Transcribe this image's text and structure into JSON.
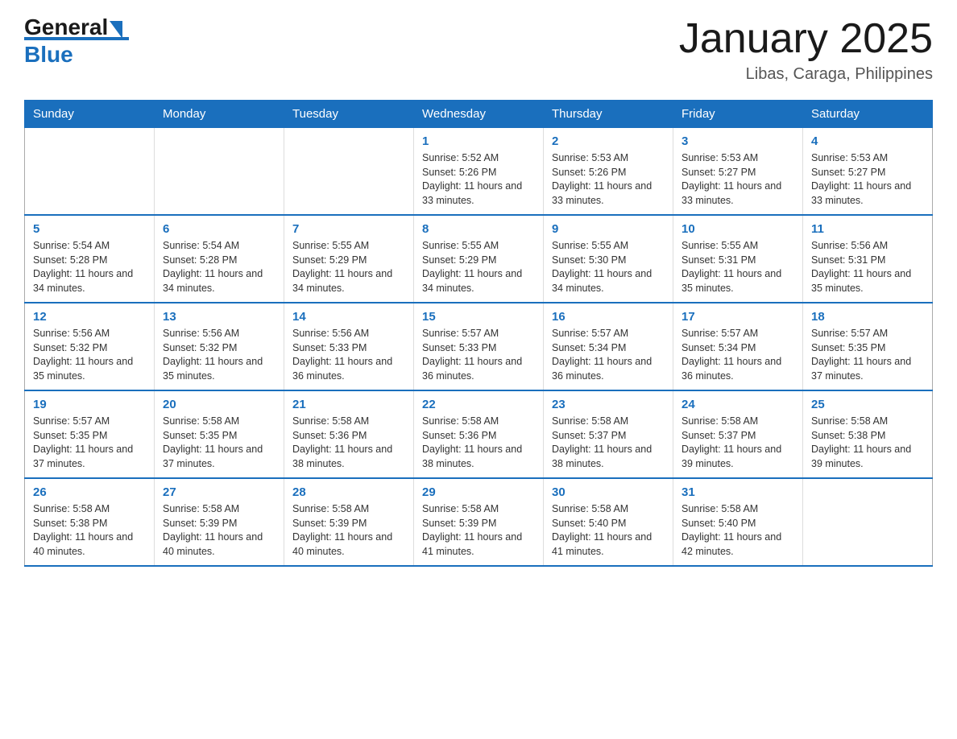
{
  "header": {
    "logo_general": "General",
    "logo_blue": "Blue",
    "month_title": "January 2025",
    "location": "Libas, Caraga, Philippines"
  },
  "days_of_week": [
    "Sunday",
    "Monday",
    "Tuesday",
    "Wednesday",
    "Thursday",
    "Friday",
    "Saturday"
  ],
  "weeks": [
    [
      {
        "num": "",
        "info": ""
      },
      {
        "num": "",
        "info": ""
      },
      {
        "num": "",
        "info": ""
      },
      {
        "num": "1",
        "info": "Sunrise: 5:52 AM\nSunset: 5:26 PM\nDaylight: 11 hours and 33 minutes."
      },
      {
        "num": "2",
        "info": "Sunrise: 5:53 AM\nSunset: 5:26 PM\nDaylight: 11 hours and 33 minutes."
      },
      {
        "num": "3",
        "info": "Sunrise: 5:53 AM\nSunset: 5:27 PM\nDaylight: 11 hours and 33 minutes."
      },
      {
        "num": "4",
        "info": "Sunrise: 5:53 AM\nSunset: 5:27 PM\nDaylight: 11 hours and 33 minutes."
      }
    ],
    [
      {
        "num": "5",
        "info": "Sunrise: 5:54 AM\nSunset: 5:28 PM\nDaylight: 11 hours and 34 minutes."
      },
      {
        "num": "6",
        "info": "Sunrise: 5:54 AM\nSunset: 5:28 PM\nDaylight: 11 hours and 34 minutes."
      },
      {
        "num": "7",
        "info": "Sunrise: 5:55 AM\nSunset: 5:29 PM\nDaylight: 11 hours and 34 minutes."
      },
      {
        "num": "8",
        "info": "Sunrise: 5:55 AM\nSunset: 5:29 PM\nDaylight: 11 hours and 34 minutes."
      },
      {
        "num": "9",
        "info": "Sunrise: 5:55 AM\nSunset: 5:30 PM\nDaylight: 11 hours and 34 minutes."
      },
      {
        "num": "10",
        "info": "Sunrise: 5:55 AM\nSunset: 5:31 PM\nDaylight: 11 hours and 35 minutes."
      },
      {
        "num": "11",
        "info": "Sunrise: 5:56 AM\nSunset: 5:31 PM\nDaylight: 11 hours and 35 minutes."
      }
    ],
    [
      {
        "num": "12",
        "info": "Sunrise: 5:56 AM\nSunset: 5:32 PM\nDaylight: 11 hours and 35 minutes."
      },
      {
        "num": "13",
        "info": "Sunrise: 5:56 AM\nSunset: 5:32 PM\nDaylight: 11 hours and 35 minutes."
      },
      {
        "num": "14",
        "info": "Sunrise: 5:56 AM\nSunset: 5:33 PM\nDaylight: 11 hours and 36 minutes."
      },
      {
        "num": "15",
        "info": "Sunrise: 5:57 AM\nSunset: 5:33 PM\nDaylight: 11 hours and 36 minutes."
      },
      {
        "num": "16",
        "info": "Sunrise: 5:57 AM\nSunset: 5:34 PM\nDaylight: 11 hours and 36 minutes."
      },
      {
        "num": "17",
        "info": "Sunrise: 5:57 AM\nSunset: 5:34 PM\nDaylight: 11 hours and 36 minutes."
      },
      {
        "num": "18",
        "info": "Sunrise: 5:57 AM\nSunset: 5:35 PM\nDaylight: 11 hours and 37 minutes."
      }
    ],
    [
      {
        "num": "19",
        "info": "Sunrise: 5:57 AM\nSunset: 5:35 PM\nDaylight: 11 hours and 37 minutes."
      },
      {
        "num": "20",
        "info": "Sunrise: 5:58 AM\nSunset: 5:35 PM\nDaylight: 11 hours and 37 minutes."
      },
      {
        "num": "21",
        "info": "Sunrise: 5:58 AM\nSunset: 5:36 PM\nDaylight: 11 hours and 38 minutes."
      },
      {
        "num": "22",
        "info": "Sunrise: 5:58 AM\nSunset: 5:36 PM\nDaylight: 11 hours and 38 minutes."
      },
      {
        "num": "23",
        "info": "Sunrise: 5:58 AM\nSunset: 5:37 PM\nDaylight: 11 hours and 38 minutes."
      },
      {
        "num": "24",
        "info": "Sunrise: 5:58 AM\nSunset: 5:37 PM\nDaylight: 11 hours and 39 minutes."
      },
      {
        "num": "25",
        "info": "Sunrise: 5:58 AM\nSunset: 5:38 PM\nDaylight: 11 hours and 39 minutes."
      }
    ],
    [
      {
        "num": "26",
        "info": "Sunrise: 5:58 AM\nSunset: 5:38 PM\nDaylight: 11 hours and 40 minutes."
      },
      {
        "num": "27",
        "info": "Sunrise: 5:58 AM\nSunset: 5:39 PM\nDaylight: 11 hours and 40 minutes."
      },
      {
        "num": "28",
        "info": "Sunrise: 5:58 AM\nSunset: 5:39 PM\nDaylight: 11 hours and 40 minutes."
      },
      {
        "num": "29",
        "info": "Sunrise: 5:58 AM\nSunset: 5:39 PM\nDaylight: 11 hours and 41 minutes."
      },
      {
        "num": "30",
        "info": "Sunrise: 5:58 AM\nSunset: 5:40 PM\nDaylight: 11 hours and 41 minutes."
      },
      {
        "num": "31",
        "info": "Sunrise: 5:58 AM\nSunset: 5:40 PM\nDaylight: 11 hours and 42 minutes."
      },
      {
        "num": "",
        "info": ""
      }
    ]
  ]
}
